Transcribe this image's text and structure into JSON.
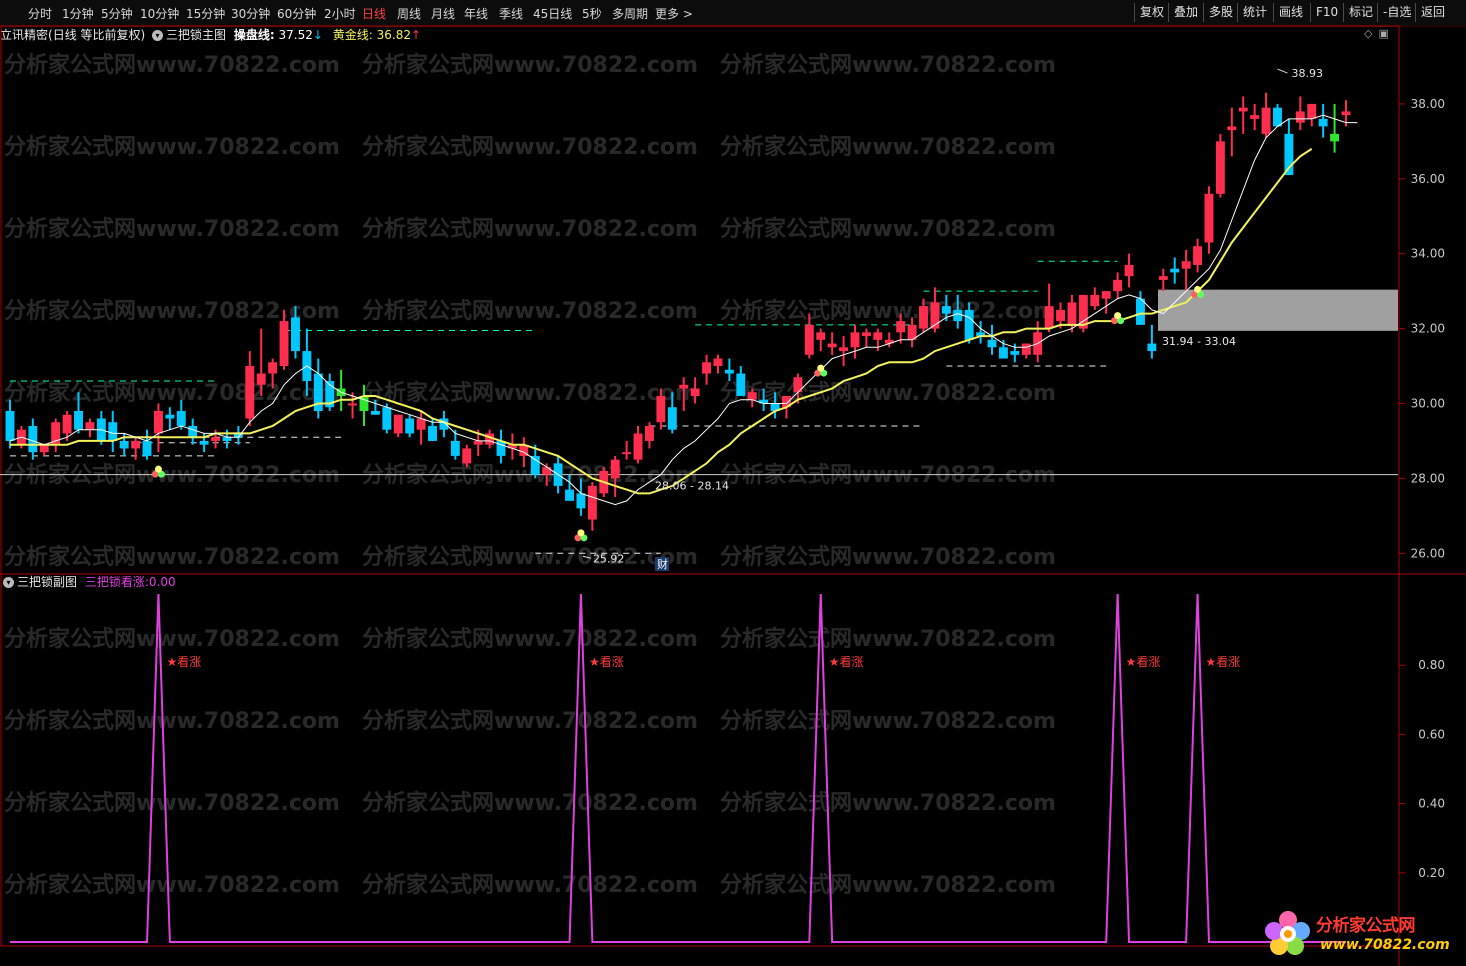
{
  "toolbar": {
    "periods": [
      "分时",
      "1分钟",
      "5分钟",
      "10分钟",
      "15分钟",
      "30分钟",
      "60分钟",
      "2小时",
      "日线",
      "周线",
      "月线",
      "年线",
      "季线",
      "45日线",
      "5秒",
      "多周期",
      "更多 >"
    ],
    "active_period": "日线",
    "tools": [
      "复权",
      "叠加",
      "多股",
      "统计",
      "画线",
      "F10",
      "标记",
      "-自选",
      "返回"
    ]
  },
  "header": {
    "stock_name": "立讯精密",
    "mode": "(日线 等比前复权)",
    "indicator_name": "三把锁主图",
    "line1_label": "操盘线:",
    "line1_value": "37.52",
    "line1_arrow": "↓",
    "line2_label": "黄金线:",
    "line2_value": "36.82",
    "line2_arrow": "↑"
  },
  "subheader": {
    "indicator_name": "三把锁副图",
    "signal_label": "三把锁看涨:",
    "signal_value": "0.00"
  },
  "watermark": "分析家公式网www.70822.com",
  "logo": {
    "title": "分析家公式网",
    "url": "www.70822.com"
  },
  "colors": {
    "up": "#ff2e4e",
    "down": "#00c8ff",
    "green": "#2ee62e",
    "line_operate": "#ffffff",
    "line_gold": "#f2f25a",
    "signal": "#e040e0",
    "axis": "#b00000",
    "box": "#a0a0a0"
  },
  "chart_data": [
    {
      "type": "candlestick",
      "title": "三把锁主图",
      "ylim": [
        25.5,
        39.6
      ],
      "yticks": [
        "26.00",
        "28.00",
        "30.00",
        "32.00",
        "34.00",
        "36.00",
        "38.00"
      ],
      "candles": [
        [
          29.8,
          30.1,
          28.8,
          29.0
        ],
        [
          28.9,
          29.4,
          28.8,
          29.3
        ],
        [
          29.4,
          29.6,
          28.5,
          28.7
        ],
        [
          28.7,
          28.9,
          28.6,
          28.9
        ],
        [
          28.9,
          29.6,
          28.7,
          29.5
        ],
        [
          29.2,
          29.8,
          29.0,
          29.7
        ],
        [
          29.8,
          30.3,
          29.2,
          29.3
        ],
        [
          29.3,
          29.6,
          29.1,
          29.5
        ],
        [
          29.6,
          29.8,
          28.9,
          29.0
        ],
        [
          29.5,
          29.8,
          28.7,
          29.0
        ],
        [
          29.0,
          29.2,
          28.6,
          28.8
        ],
        [
          28.8,
          29.1,
          28.5,
          29.0
        ],
        [
          29.0,
          29.3,
          28.5,
          28.6
        ],
        [
          29.2,
          30.0,
          28.7,
          29.8
        ],
        [
          29.7,
          29.9,
          29.3,
          29.6
        ],
        [
          29.8,
          30.1,
          29.3,
          29.4
        ],
        [
          29.4,
          29.6,
          28.9,
          29.1
        ],
        [
          29.0,
          29.2,
          28.7,
          28.9
        ],
        [
          29.0,
          29.3,
          28.8,
          29.1
        ],
        [
          29.1,
          29.3,
          28.8,
          29.0
        ],
        [
          29.2,
          29.4,
          28.9,
          29.1
        ],
        [
          29.6,
          31.4,
          29.4,
          31.0
        ],
        [
          30.5,
          32.0,
          30.2,
          30.8
        ],
        [
          30.8,
          31.2,
          30.4,
          31.1
        ],
        [
          31.0,
          32.5,
          30.9,
          32.2
        ],
        [
          32.3,
          32.6,
          31.2,
          31.4
        ],
        [
          31.4,
          32.0,
          30.2,
          30.6
        ],
        [
          30.8,
          31.2,
          29.6,
          29.8
        ],
        [
          30.6,
          30.8,
          29.8,
          29.9
        ],
        [
          30.4,
          30.9,
          29.8,
          30.2
        ],
        [
          30.0,
          30.3,
          29.6,
          30.0
        ],
        [
          30.2,
          30.5,
          29.4,
          29.8
        ],
        [
          29.8,
          30.1,
          29.7,
          29.7
        ],
        [
          29.9,
          30.0,
          29.2,
          29.3
        ],
        [
          29.2,
          29.7,
          29.1,
          29.7
        ],
        [
          29.6,
          29.7,
          29.1,
          29.2
        ],
        [
          29.3,
          29.8,
          28.9,
          29.6
        ],
        [
          29.4,
          29.6,
          29.0,
          29.0
        ],
        [
          29.6,
          29.8,
          29.1,
          29.3
        ],
        [
          29.0,
          29.3,
          28.5,
          28.6
        ],
        [
          28.4,
          28.9,
          28.3,
          28.8
        ],
        [
          28.9,
          29.3,
          28.6,
          29.0
        ],
        [
          28.9,
          29.3,
          28.8,
          29.2
        ],
        [
          29.0,
          29.3,
          28.4,
          28.6
        ],
        [
          28.8,
          29.2,
          28.5,
          28.9
        ],
        [
          28.6,
          29.1,
          28.3,
          28.9
        ],
        [
          28.6,
          28.9,
          28.0,
          28.1
        ],
        [
          28.1,
          28.4,
          27.8,
          28.3
        ],
        [
          28.4,
          28.6,
          27.6,
          27.8
        ],
        [
          27.7,
          28.1,
          27.6,
          27.4
        ],
        [
          27.6,
          28.0,
          27.0,
          27.2
        ],
        [
          26.9,
          27.9,
          26.6,
          27.8
        ],
        [
          27.6,
          28.3,
          27.5,
          28.2
        ],
        [
          28.0,
          28.6,
          27.5,
          28.5
        ],
        [
          28.7,
          29.0,
          28.5,
          28.7
        ],
        [
          28.5,
          29.4,
          28.4,
          29.2
        ],
        [
          29.0,
          29.5,
          28.8,
          29.4
        ],
        [
          29.5,
          30.4,
          29.3,
          30.2
        ],
        [
          29.9,
          30.3,
          29.2,
          29.3
        ],
        [
          30.4,
          30.7,
          29.8,
          30.5
        ],
        [
          30.2,
          30.7,
          30.0,
          30.4
        ],
        [
          30.8,
          31.3,
          30.5,
          31.1
        ],
        [
          31.0,
          31.3,
          30.8,
          31.2
        ],
        [
          30.9,
          31.2,
          30.6,
          30.8
        ],
        [
          30.8,
          31.0,
          30.2,
          30.2
        ],
        [
          30.1,
          30.4,
          29.9,
          30.3
        ],
        [
          30.1,
          30.4,
          29.8,
          30.0
        ],
        [
          30.0,
          30.3,
          29.6,
          29.8
        ],
        [
          29.9,
          30.2,
          29.6,
          30.2
        ],
        [
          30.3,
          30.8,
          30.0,
          30.7
        ],
        [
          31.3,
          32.4,
          31.2,
          32.1
        ],
        [
          31.7,
          32.0,
          31.4,
          31.9
        ],
        [
          31.5,
          31.9,
          31.3,
          31.6
        ],
        [
          31.4,
          31.8,
          31.0,
          31.5
        ],
        [
          31.5,
          32.1,
          31.2,
          31.9
        ],
        [
          31.8,
          32.0,
          31.5,
          31.9
        ],
        [
          31.7,
          32.0,
          31.4,
          31.9
        ],
        [
          31.6,
          31.9,
          31.5,
          31.7
        ],
        [
          31.9,
          32.4,
          31.6,
          32.2
        ],
        [
          31.7,
          32.3,
          31.5,
          32.1
        ],
        [
          32.0,
          32.8,
          31.9,
          32.6
        ],
        [
          32.0,
          33.1,
          31.9,
          32.7
        ],
        [
          32.6,
          32.9,
          32.2,
          32.4
        ],
        [
          32.5,
          32.9,
          32.0,
          32.2
        ],
        [
          32.5,
          32.7,
          31.6,
          31.7
        ],
        [
          31.9,
          32.2,
          31.6,
          31.8
        ],
        [
          31.7,
          32.1,
          31.3,
          31.5
        ],
        [
          31.5,
          31.7,
          31.3,
          31.2
        ],
        [
          31.4,
          31.6,
          31.1,
          31.3
        ],
        [
          31.3,
          31.6,
          31.2,
          31.6
        ],
        [
          31.3,
          32.2,
          31.1,
          31.9
        ],
        [
          32.0,
          33.2,
          31.9,
          32.6
        ],
        [
          32.2,
          32.7,
          32.0,
          32.5
        ],
        [
          32.1,
          32.9,
          31.9,
          32.7
        ],
        [
          32.0,
          32.9,
          31.9,
          32.9
        ],
        [
          32.6,
          33.1,
          32.5,
          32.9
        ],
        [
          32.8,
          33.0,
          32.4,
          33.0
        ],
        [
          33.0,
          33.5,
          32.8,
          33.3
        ],
        [
          33.4,
          34.0,
          33.1,
          33.7
        ],
        [
          32.8,
          33.0,
          32.1,
          32.1
        ],
        [
          31.6,
          32.1,
          31.2,
          31.4
        ],
        [
          33.3,
          33.6,
          33.0,
          33.4
        ],
        [
          33.6,
          33.9,
          33.2,
          33.5
        ],
        [
          33.6,
          34.1,
          33.0,
          33.8
        ],
        [
          33.7,
          34.4,
          33.5,
          34.2
        ],
        [
          34.3,
          35.8,
          34.0,
          35.6
        ],
        [
          35.6,
          37.2,
          35.5,
          37.0
        ],
        [
          37.3,
          37.9,
          36.6,
          37.4
        ],
        [
          37.8,
          38.2,
          37.2,
          37.9
        ],
        [
          37.6,
          38.0,
          37.3,
          37.7
        ],
        [
          37.2,
          38.3,
          37.1,
          37.9
        ],
        [
          37.9,
          38.0,
          37.4,
          37.4
        ],
        [
          37.2,
          37.6,
          36.1,
          36.1
        ],
        [
          37.5,
          38.2,
          37.3,
          37.8
        ],
        [
          37.6,
          37.9,
          37.4,
          38.0
        ],
        [
          37.6,
          38.0,
          37.1,
          37.4
        ],
        [
          37.2,
          38.0,
          36.7,
          37.0
        ],
        [
          37.7,
          38.1,
          37.4,
          37.8
        ]
      ],
      "series": [
        {
          "name": "操盘线",
          "values": [
            29.0,
            29.1,
            29.0,
            28.9,
            29.0,
            29.1,
            29.3,
            29.3,
            29.3,
            29.2,
            29.2,
            29.1,
            29.0,
            29.2,
            29.3,
            29.4,
            29.3,
            29.2,
            29.2,
            29.1,
            29.1,
            29.5,
            29.8,
            30.0,
            30.5,
            30.8,
            31.0,
            30.8,
            30.5,
            30.3,
            30.2,
            30.1,
            30.0,
            29.9,
            29.8,
            29.7,
            29.6,
            29.5,
            29.5,
            29.2,
            29.1,
            29.0,
            29.0,
            28.9,
            28.8,
            28.7,
            28.5,
            28.3,
            28.1,
            27.9,
            27.6,
            27.5,
            27.4,
            27.3,
            27.4,
            27.7,
            27.9,
            28.1,
            28.5,
            28.8,
            29.0,
            29.3,
            29.6,
            30.0,
            30.1,
            30.1,
            30.0,
            30.0,
            30.0,
            30.3,
            30.6,
            30.9,
            31.2,
            31.3,
            31.4,
            31.5,
            31.5,
            31.6,
            31.7,
            31.7,
            31.9,
            32.1,
            32.3,
            32.4,
            32.3,
            32.0,
            31.8,
            31.6,
            31.5,
            31.5,
            31.6,
            31.8,
            31.9,
            32.0,
            32.2,
            32.4,
            32.6,
            32.8,
            32.9,
            32.8,
            32.5,
            32.4,
            32.7,
            33.0,
            33.3,
            33.6,
            34.1,
            34.9,
            35.7,
            36.5,
            37.1,
            37.4,
            37.6,
            37.6,
            37.6,
            37.7,
            37.6,
            37.5,
            37.5
          ]
        },
        {
          "name": "黄金线",
          "values": [
            28.9,
            28.9,
            28.9,
            28.9,
            28.9,
            28.9,
            29.0,
            29.0,
            29.0,
            29.0,
            29.1,
            29.1,
            29.1,
            29.1,
            29.1,
            29.1,
            29.1,
            29.1,
            29.2,
            29.2,
            29.2,
            29.2,
            29.3,
            29.4,
            29.6,
            29.8,
            29.9,
            30.0,
            30.0,
            30.1,
            30.1,
            30.2,
            30.2,
            30.1,
            30.0,
            29.9,
            29.8,
            29.6,
            29.5,
            29.4,
            29.3,
            29.2,
            29.1,
            29.0,
            28.9,
            28.9,
            28.8,
            28.7,
            28.6,
            28.4,
            28.2,
            28.0,
            27.9,
            27.8,
            27.7,
            27.6,
            27.6,
            27.7,
            27.8,
            28.0,
            28.2,
            28.4,
            28.7,
            28.9,
            29.2,
            29.4,
            29.6,
            29.8,
            29.9,
            30.1,
            30.2,
            30.3,
            30.4,
            30.6,
            30.7,
            30.8,
            31.0,
            31.1,
            31.1,
            31.1,
            31.2,
            31.4,
            31.5,
            31.6,
            31.7,
            31.8,
            31.8,
            31.9,
            31.9,
            32.0,
            32.0,
            32.0,
            32.1,
            32.1,
            32.1,
            32.2,
            32.2,
            32.2,
            32.3,
            32.4,
            32.4,
            32.5,
            32.6,
            32.7,
            33.0,
            33.3,
            33.8,
            34.3,
            34.7,
            35.1,
            35.5,
            35.9,
            36.3,
            36.6,
            36.8
          ]
        }
      ],
      "annotations": [
        {
          "text": "38.93",
          "x": 111,
          "y": 38.93
        },
        {
          "text": "31.94 - 33.04",
          "zone": [
            31.94,
            33.04
          ]
        },
        {
          "text": "28.06 - 28.14",
          "x": 54,
          "y": 28.1
        },
        {
          "text": "25.92",
          "x": 50,
          "y": 25.92
        },
        {
          "text": "财",
          "x": 54
        }
      ],
      "hline": 28.1
    },
    {
      "type": "line",
      "title": "三把锁副图",
      "ylim": [
        0,
        1
      ],
      "yticks": [
        "0.20",
        "0.40",
        "0.60",
        "0.80"
      ],
      "series": [
        {
          "name": "三把锁看涨",
          "spikes": [
            13,
            50,
            71,
            97,
            104
          ]
        }
      ],
      "signal_text": "★看涨"
    }
  ]
}
